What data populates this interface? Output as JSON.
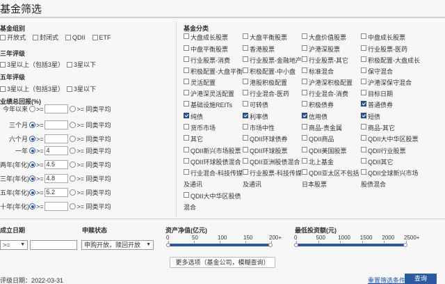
{
  "title": "基金筛选",
  "group": {
    "label": "基金组别",
    "options": [
      "开放式",
      "封闭式",
      "QDII",
      "ETF"
    ]
  },
  "rating3": {
    "label": "三年评级",
    "options": [
      "3星以上（包括3星）",
      "3星以下"
    ]
  },
  "rating5": {
    "label": "五年评级",
    "options": [
      "3星以上（包括3星）",
      "3星以下"
    ]
  },
  "performance": {
    "label": "业绩总回报(%)",
    "ge": ">=",
    "ge_avg": ">= 同类平均",
    "rows": [
      {
        "label": "今年以来",
        "value": "",
        "selected": "none"
      },
      {
        "label": "三个月",
        "value": "",
        "selected": "ge"
      },
      {
        "label": "六个月",
        "value": "",
        "selected": "ge"
      },
      {
        "label": "一年",
        "value": "4",
        "selected": "ge"
      },
      {
        "label": "两年(年化)",
        "value": "4.5",
        "selected": "ge"
      },
      {
        "label": "三年(年化)",
        "value": "4.8",
        "selected": "ge"
      },
      {
        "label": "五年(年化)",
        "value": "5.2",
        "selected": "ge"
      },
      {
        "label": "十年(年化)",
        "value": "",
        "selected": "ge"
      }
    ]
  },
  "categories": {
    "label": "基金分类",
    "items": [
      {
        "label": "大盘成长股票",
        "checked": false
      },
      {
        "label": "大盘平衡股票",
        "checked": false
      },
      {
        "label": "大盘价值股票",
        "checked": false
      },
      {
        "label": "中盘成长股票",
        "checked": false
      },
      {
        "label": "中盘平衡股票",
        "checked": false
      },
      {
        "label": "香港股票",
        "checked": false
      },
      {
        "label": "沪港深股票",
        "checked": false
      },
      {
        "label": "行业股票-医药",
        "checked": false
      },
      {
        "label": "行业股票-消费",
        "checked": false
      },
      {
        "label": "行业股票-金融地产",
        "checked": false
      },
      {
        "label": "行业股票-其它",
        "checked": false
      },
      {
        "label": "积极配置-大盘成长",
        "checked": false
      },
      {
        "label": "积极配置-大盘平衡",
        "checked": false
      },
      {
        "label": "积极配置-中小盘",
        "checked": false
      },
      {
        "label": "标准混合",
        "checked": false
      },
      {
        "label": "保守混合",
        "checked": false
      },
      {
        "label": "灵活配置",
        "checked": false
      },
      {
        "label": "港股积极配置",
        "checked": false
      },
      {
        "label": "沪港深积极配置",
        "checked": false
      },
      {
        "label": "沪港深保守混合",
        "checked": false
      },
      {
        "label": "沪港深灵活配置",
        "checked": false
      },
      {
        "label": "行业混合-医药",
        "checked": false
      },
      {
        "label": "行业混合-消费",
        "checked": false
      },
      {
        "label": "目标日期",
        "checked": false
      },
      {
        "label": "基础设施REITs",
        "checked": false
      },
      {
        "label": "可转债",
        "checked": false
      },
      {
        "label": "积极债券",
        "checked": false
      },
      {
        "label": "普通债券",
        "checked": true
      },
      {
        "label": "纯债",
        "checked": true
      },
      {
        "label": "利率债",
        "checked": true
      },
      {
        "label": "信用债",
        "checked": true
      },
      {
        "label": "短债",
        "checked": true
      },
      {
        "label": "货币市场",
        "checked": false
      },
      {
        "label": "市场中性",
        "checked": false
      },
      {
        "label": "商品-贵金属",
        "checked": false
      },
      {
        "label": "商品-其它",
        "checked": false
      },
      {
        "label": "其它",
        "checked": false
      },
      {
        "label": "QDII环球债券",
        "checked": false
      },
      {
        "label": "QDII商品",
        "checked": false
      },
      {
        "label": "QDII大中华区股票",
        "checked": false
      },
      {
        "label": "QDII新兴市场股票",
        "checked": false
      },
      {
        "label": "QDII环球股票",
        "checked": false
      },
      {
        "label": "QDII美国股票",
        "checked": false
      },
      {
        "label": "QDII行业股票",
        "checked": false
      },
      {
        "label": "QDII环球股债混合",
        "checked": false
      },
      {
        "label": "QDII亚洲股债混合",
        "checked": false
      },
      {
        "label": "北上基金",
        "checked": false
      },
      {
        "label": "QDII其它",
        "checked": false
      },
      {
        "label": "行业混合-科技传媒",
        "cont": "及通讯",
        "checked": false
      },
      {
        "label": "行业股票-科技传媒",
        "cont": "及通讯",
        "checked": false
      },
      {
        "label": "QDII亚太区不包括",
        "cont": "日本股票",
        "checked": false
      },
      {
        "label": "QDII全球新兴市场",
        "cont": "股债混合",
        "checked": false
      },
      {
        "label": "QDII大中华区股债",
        "cont": "混合",
        "checked": false
      }
    ]
  },
  "inception": {
    "label": "成立日期",
    "op": ">=",
    "value": ""
  },
  "subscription": {
    "label": "申赎状态",
    "value": "申购开放，赎回开放"
  },
  "nav": {
    "label": "资产净值(亿元)",
    "ticks": [
      "0",
      "50",
      "100",
      "150",
      "200+"
    ]
  },
  "min_invest": {
    "label": "最低投资额(元)",
    "ticks": [
      "0",
      "500",
      "1000",
      "1500",
      "2000",
      "2500+"
    ]
  },
  "more_button": "更多选项（基金公司，模糊查询）",
  "rating_date": "评级日期：2022-03-31",
  "reset_label": "重置筛选条件",
  "query_label": "查询",
  "colors": {
    "accent": "#2c5aa0",
    "link": "#2255aa"
  }
}
